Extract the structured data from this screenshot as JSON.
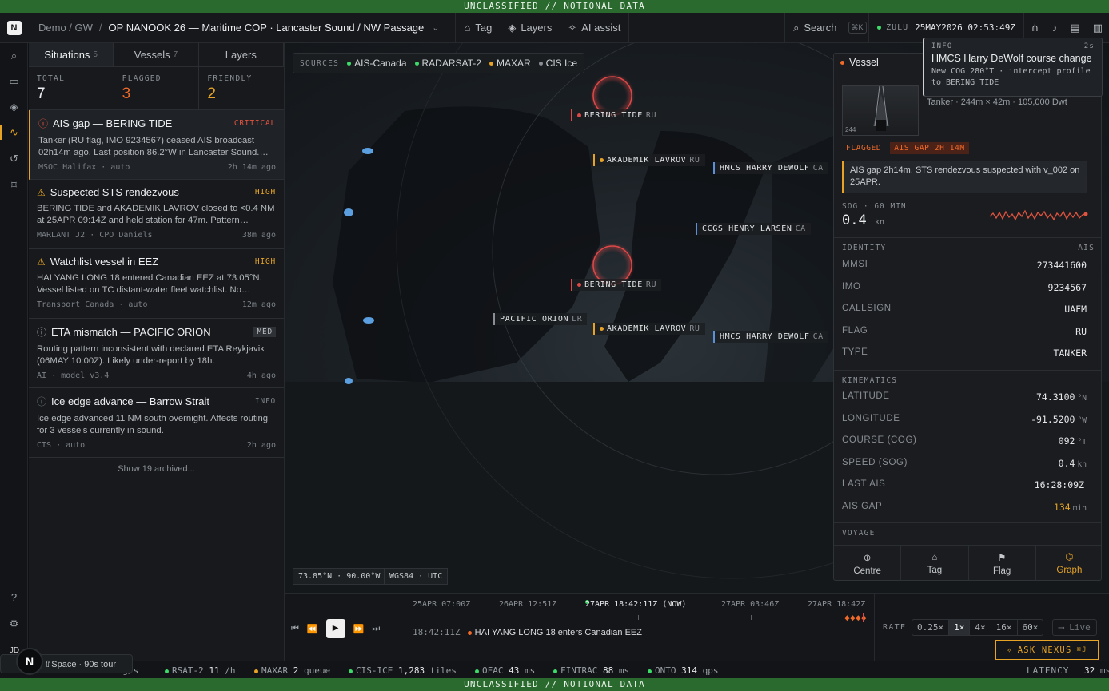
{
  "banner": "UNCLASSIFIED // NOTIONAL DATA",
  "app": {
    "logo": "N",
    "breadcrumb": "Demo / GW",
    "separator": "/",
    "title": "OP NANOOK 26 — Maritime COP · Lancaster Sound / NW Passage"
  },
  "toolbar": {
    "tag": "Tag",
    "layers": "Layers",
    "ai": "AI assist",
    "search": "Search",
    "search_kbd": "⌘K",
    "zulu_label": "ZULU",
    "zulu_time": "25MAY2026 02:53:49Z"
  },
  "sidebar": {
    "user": "JD"
  },
  "left": {
    "tabs": [
      {
        "label": "Situations",
        "count": "5"
      },
      {
        "label": "Vessels",
        "count": "7"
      },
      {
        "label": "Layers",
        "count": ""
      }
    ],
    "stats": [
      {
        "label": "TOTAL",
        "value": "7",
        "color": "#eceef0"
      },
      {
        "label": "FLAGGED",
        "value": "3",
        "color": "#f06a2a"
      },
      {
        "label": "FRIENDLY",
        "value": "2",
        "color": "#e6a325"
      }
    ],
    "situations": [
      {
        "title": "AIS gap — BERING TIDE",
        "severity": "CRITICAL",
        "sev_color": "#e0533f",
        "body": "Tanker (RU flag, IMO 9234567) ceased AIS broadcast 02h14m ago. Last position 86.2°W in Lancaster Sound.…",
        "source": "MSOC Halifax · auto",
        "age": "2h 14m ago"
      },
      {
        "title": "Suspected STS rendezvous",
        "severity": "HIGH",
        "sev_color": "#e6a325",
        "body": "BERING TIDE and AKADEMIK LAVROV closed to <0.4 NM at 25APR 09:14Z and held station for 47m. Pattern…",
        "source": "MARLANT J2 · CPO Daniels",
        "age": "38m ago"
      },
      {
        "title": "Watchlist vessel in EEZ",
        "severity": "HIGH",
        "sev_color": "#e6a325",
        "body": "HAI YANG LONG 18 entered Canadian EEZ at 73.05°N. Vessel listed on TC distant-water fleet watchlist. No…",
        "source": "Transport Canada · auto",
        "age": "12m ago"
      },
      {
        "title": "ETA mismatch — PACIFIC ORION",
        "severity": "MED",
        "sev_color": "#b9bdc2",
        "body": "Routing pattern inconsistent with declared ETA Reykjavik (06MAY 10:00Z). Likely under-report by 18h.",
        "source": "AI · model v3.4",
        "age": "4h ago"
      },
      {
        "title": "Ice edge advance — Barrow Strait",
        "severity": "INFO",
        "sev_color": "#7b8087",
        "body": "Ice edge advanced 11 NM south overnight. Affects routing for 3 vessels currently in sound.",
        "source": "CIS · auto",
        "age": "2h ago"
      }
    ],
    "show_archived": "Show 19 archived..."
  },
  "map": {
    "sources_label": "SOURCES",
    "sources": [
      {
        "name": "AIS-Canada",
        "color": "#3ddc6a"
      },
      {
        "name": "RADARSAT-2",
        "color": "#3ddc6a"
      },
      {
        "name": "MAXAR",
        "color": "#e6a325"
      },
      {
        "name": "CIS Ice",
        "color": "#8a8f95"
      }
    ],
    "labels": [
      {
        "name": "BERING TIDE",
        "flag": "RU",
        "color": "#e04848"
      },
      {
        "name": "AKADEMIK LAVROV",
        "flag": "RU",
        "color": "#e6a325"
      },
      {
        "name": "HMCS HARRY DEWOLF",
        "flag": "CA",
        "color": "#5b8fd6"
      },
      {
        "name": "CCGS HENRY LARSEN",
        "flag": "CA",
        "color": "#5b8fd6"
      },
      {
        "name": "BERING TIDE",
        "flag": "RU",
        "color": "#e04848"
      },
      {
        "name": "PACIFIC ORION",
        "flag": "LR",
        "color": "#8a8f95"
      },
      {
        "name": "AKADEMIK LAVROV",
        "flag": "RU",
        "color": "#e6a325"
      },
      {
        "name": "HMCS HARRY DEWOLF",
        "flag": "CA",
        "color": "#5b8fd6"
      }
    ],
    "coords": "73.85°N · 90.00°W",
    "datum": "WGS84 · UTC"
  },
  "timeline": {
    "stamps": [
      "25APR 07:00Z",
      "26APR 12:51Z",
      "27APR 18:42:11Z (NOW)",
      "27APR 03:46Z",
      "27APR 18:42Z"
    ],
    "event_time": "18:42:11Z",
    "event_text": "HAI YANG LONG 18 enters Canadian EEZ"
  },
  "rate": {
    "label": "RATE",
    "options": [
      "0.25×",
      "1×",
      "4×",
      "16×",
      "60×"
    ],
    "selected": "1×",
    "live": "⟶ Live",
    "ask": "ASK NEXUS",
    "ask_kbd": "⌘J"
  },
  "status": [
    {
      "name": "RSAT-2",
      "value": "11",
      "unit": "/h",
      "color": "#3ddc6a"
    },
    {
      "name": "MAXAR",
      "value": "2",
      "unit": "queue",
      "color": "#e6a325"
    },
    {
      "name": "CIS-ICE",
      "value": "1,283",
      "unit": "tiles",
      "color": "#3ddc6a"
    },
    {
      "name": "OFAC",
      "value": "43",
      "unit": "ms",
      "color": "#3ddc6a"
    },
    {
      "name": "FINTRAC",
      "value": "88",
      "unit": "ms",
      "color": "#3ddc6a"
    },
    {
      "name": "ONTO",
      "value": "314",
      "unit": "qps",
      "color": "#3ddc6a"
    }
  ],
  "status_partial": "msg/s",
  "latency": {
    "label": "LATENCY",
    "value": "32",
    "unit": "ms"
  },
  "tour": {
    "logo": "N",
    "text": "ss ⇧Space · 90s tour"
  },
  "panel": {
    "title": "Vessel",
    "thumb_label": "244",
    "meta": "Tanker · 244m × 42m · 105,000 Dwt",
    "tags": [
      "FLAGGED",
      "AIS GAP 2H 14M"
    ],
    "note": "AIS gap 2h14m. STS rendezvous suspected with v_002 on 25APR.",
    "sog_label": "SOG · 60 MIN",
    "sog_value": "0.4",
    "sog_unit": "kn",
    "identity_label": "IDENTITY",
    "identity_src": "AIS",
    "identity": [
      {
        "k": "MMSI",
        "v": "273441600"
      },
      {
        "k": "IMO",
        "v": "9234567"
      },
      {
        "k": "CALLSIGN",
        "v": "UAFM"
      },
      {
        "k": "FLAG",
        "v": "RU"
      },
      {
        "k": "TYPE",
        "v": "TANKER"
      }
    ],
    "kin_label": "KINEMATICS",
    "kinematics": [
      {
        "k": "LATITUDE",
        "v": "74.3100",
        "u": "°N"
      },
      {
        "k": "LONGITUDE",
        "v": "-91.5200",
        "u": "°W"
      },
      {
        "k": "COURSE (COG)",
        "v": "092",
        "u": "°T"
      },
      {
        "k": "SPEED (SOG)",
        "v": "0.4",
        "u": "kn"
      },
      {
        "k": "LAST AIS",
        "v": "16:28:09Z",
        "u": ""
      },
      {
        "k": "AIS GAP",
        "v": "134",
        "u": "min"
      }
    ],
    "voyage_label": "VOYAGE",
    "actions": [
      "Centre",
      "Tag",
      "Flag",
      "Graph"
    ]
  },
  "toast": {
    "label": "INFO",
    "age": "2s",
    "title": "HMCS Harry DeWolf course change",
    "body": "New COG 280°T · intercept profile to BERING TIDE"
  }
}
